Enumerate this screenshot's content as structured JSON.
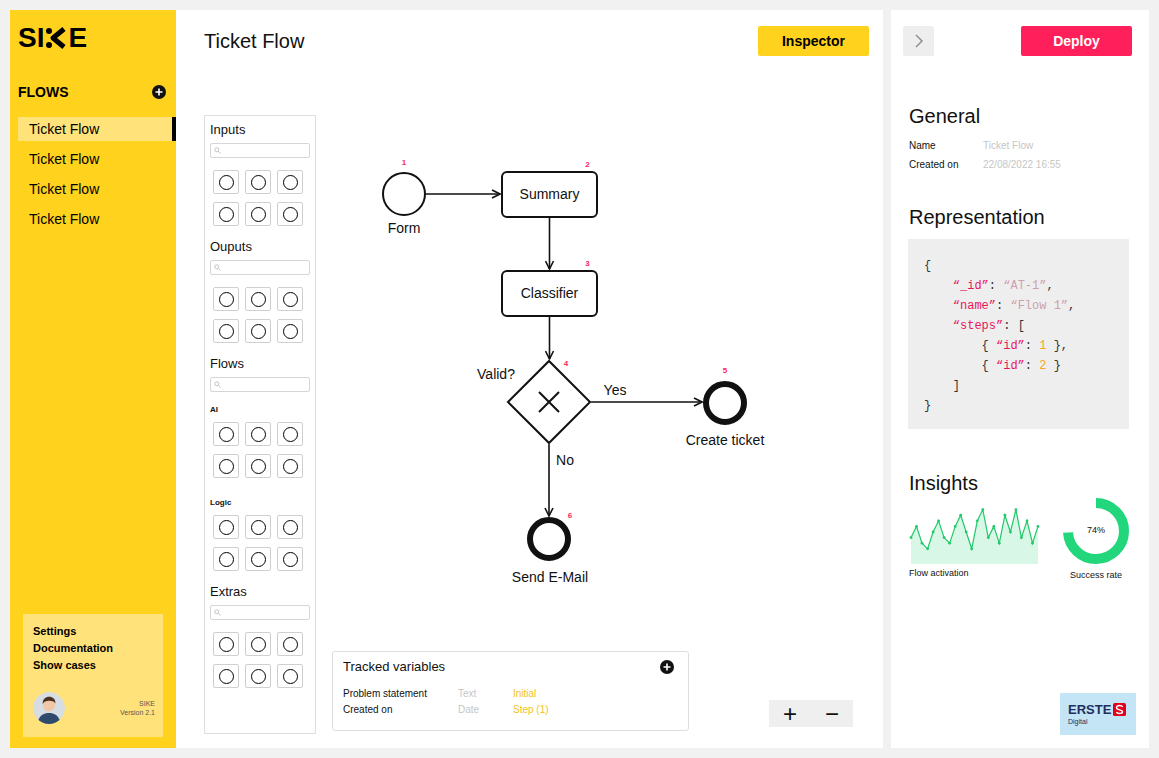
{
  "sidebar": {
    "logo": {
      "start": "SI",
      "end": "E"
    },
    "section": "FLOWS",
    "items": [
      {
        "label": "Ticket Flow",
        "selected": true
      },
      {
        "label": "Ticket Flow",
        "selected": false
      },
      {
        "label": "Ticket Flow",
        "selected": false
      },
      {
        "label": "Ticket Flow",
        "selected": false
      }
    ],
    "links": [
      "Settings",
      "Documentation",
      "Show cases"
    ],
    "product": "SIKE",
    "version": "Version 2.1"
  },
  "main": {
    "title": "Ticket Flow",
    "inspector_button": "Inspector"
  },
  "palette": {
    "sections": [
      {
        "title": "Inputs",
        "groups": [
          {
            "tile_count": 6
          }
        ]
      },
      {
        "title": "Ouputs",
        "groups": [
          {
            "tile_count": 6
          }
        ]
      },
      {
        "title": "Flows",
        "groups": [
          {
            "label": "AI",
            "tile_count": 6
          },
          {
            "label": "Logic",
            "tile_count": 6
          }
        ]
      },
      {
        "title": "Extras",
        "groups": [
          {
            "tile_count": 6
          }
        ]
      }
    ]
  },
  "diagram": {
    "nodes": [
      {
        "number": "1",
        "label": "Form",
        "kind": "start"
      },
      {
        "number": "2",
        "label": "Summary",
        "kind": "task"
      },
      {
        "number": "3",
        "label": "Classifier",
        "kind": "task"
      },
      {
        "number": "4",
        "label": "Valid?",
        "kind": "gateway"
      },
      {
        "number": "5",
        "label": "Create ticket",
        "kind": "end"
      },
      {
        "number": "6",
        "label": "Send E-Mail",
        "kind": "end"
      }
    ],
    "edges": [
      {
        "from": "1",
        "to": "2"
      },
      {
        "from": "2",
        "to": "3"
      },
      {
        "from": "3",
        "to": "4"
      },
      {
        "from": "4",
        "to": "5",
        "label": "Yes"
      },
      {
        "from": "4",
        "to": "6",
        "label": "No"
      }
    ]
  },
  "tracked_variables": {
    "title": "Tracked variables",
    "rows": [
      {
        "name": "Problem statement",
        "type": "Text",
        "value": "Initial"
      },
      {
        "name": "Created on",
        "type": "Date",
        "value": "Step (1)"
      }
    ]
  },
  "zoom": {
    "in": "+",
    "out": "−"
  },
  "inspector": {
    "deploy_button": "Deploy",
    "general": {
      "title": "General",
      "fields": [
        {
          "label": "Name",
          "value": "Ticket Flow"
        },
        {
          "label": "Created on",
          "value": "22/08/2022 16:55"
        }
      ]
    },
    "representation": {
      "title": "Representation",
      "lines": [
        [
          {
            "text": "{",
            "kind": "plain"
          }
        ],
        [
          {
            "text": "    ",
            "kind": "plain"
          },
          {
            "text": "“_id”",
            "kind": "key"
          },
          {
            "text": ": ",
            "kind": "plain"
          },
          {
            "text": "“AT-1”",
            "kind": "string"
          },
          {
            "text": ",",
            "kind": "plain"
          }
        ],
        [
          {
            "text": "    ",
            "kind": "plain"
          },
          {
            "text": "“name”",
            "kind": "key"
          },
          {
            "text": ": ",
            "kind": "plain"
          },
          {
            "text": "“Flow 1”",
            "kind": "string"
          },
          {
            "text": ",",
            "kind": "plain"
          }
        ],
        [
          {
            "text": "    ",
            "kind": "plain"
          },
          {
            "text": "“steps”",
            "kind": "key"
          },
          {
            "text": ": [",
            "kind": "plain"
          }
        ],
        [
          {
            "text": "        { ",
            "kind": "plain"
          },
          {
            "text": "“id”",
            "kind": "key"
          },
          {
            "text": ": ",
            "kind": "plain"
          },
          {
            "text": "1",
            "kind": "number"
          },
          {
            "text": " },",
            "kind": "plain"
          }
        ],
        [
          {
            "text": "        { ",
            "kind": "plain"
          },
          {
            "text": "“id”",
            "kind": "key"
          },
          {
            "text": ": ",
            "kind": "plain"
          },
          {
            "text": "2",
            "kind": "number"
          },
          {
            "text": " }",
            "kind": "plain"
          }
        ],
        [
          {
            "text": "    ]",
            "kind": "plain"
          }
        ],
        [
          {
            "text": "}",
            "kind": "plain"
          }
        ]
      ]
    },
    "insights": {
      "title": "Insights",
      "activation": {
        "label": "Flow activation",
        "values": [
          4,
          6,
          3,
          2,
          5,
          7,
          4,
          3,
          6,
          8,
          5,
          2,
          7,
          9,
          4,
          6,
          3,
          8,
          5,
          9,
          4,
          7,
          3,
          6
        ]
      },
      "success": {
        "label": "Success rate",
        "reading": "74%",
        "level": 0.74
      }
    }
  },
  "brand": {
    "name": "ERSTE",
    "sub": "Digital"
  }
}
